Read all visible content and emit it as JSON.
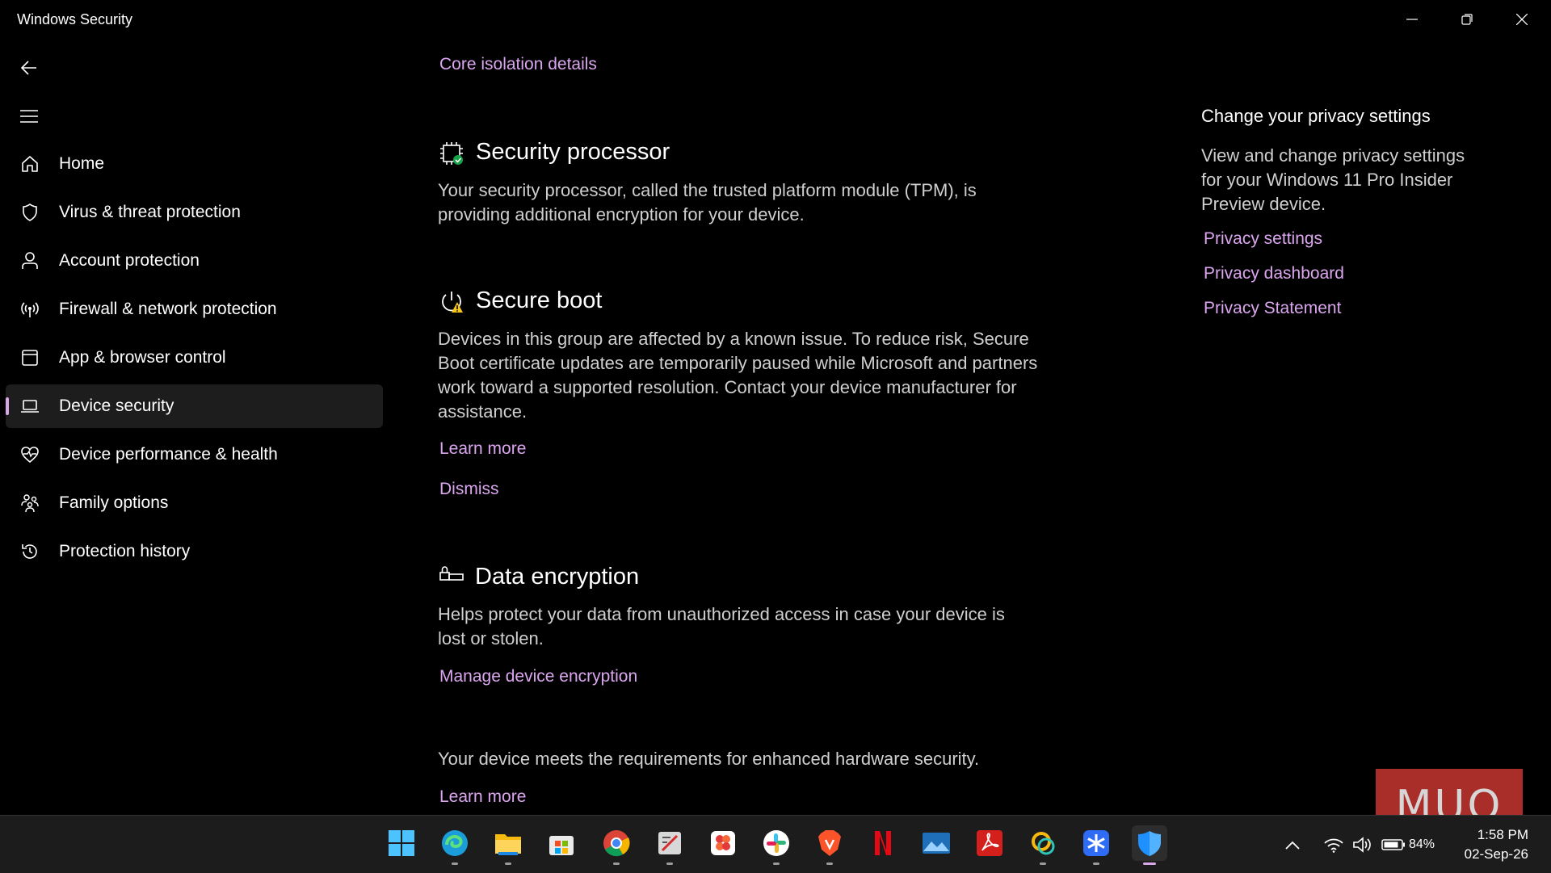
{
  "window": {
    "title": "Windows Security"
  },
  "nav": {
    "items": [
      {
        "label": "Home",
        "icon": "home-icon"
      },
      {
        "label": "Virus & threat protection",
        "icon": "shield-icon"
      },
      {
        "label": "Account protection",
        "icon": "person-icon"
      },
      {
        "label": "Firewall & network protection",
        "icon": "antenna-icon"
      },
      {
        "label": "App & browser control",
        "icon": "browser-window-icon"
      },
      {
        "label": "Device security",
        "icon": "laptop-icon",
        "active": true
      },
      {
        "label": "Device performance & health",
        "icon": "heart-pulse-icon"
      },
      {
        "label": "Family options",
        "icon": "family-icon"
      },
      {
        "label": "Protection history",
        "icon": "history-icon"
      }
    ]
  },
  "main": {
    "core_isolation_link": "Core isolation details",
    "security_processor": {
      "title": "Security processor",
      "description": "Your security processor, called the trusted platform module (TPM), is providing additional encryption for your device."
    },
    "secure_boot": {
      "title": "Secure boot",
      "description": "Devices in this group are affected by a known issue. To reduce risk, Secure Boot certificate updates are temporarily paused while Microsoft and partners work toward a supported resolution. Contact your device manufacturer for assistance.",
      "learn_more": "Learn more",
      "dismiss": "Dismiss"
    },
    "data_encryption": {
      "title": "Data encryption",
      "description": "Helps protect your data from unauthorized access in case your device is lost or stolen.",
      "manage_link": "Manage device encryption"
    },
    "footer": {
      "text": "Your device meets the requirements for enhanced hardware security.",
      "learn_more": "Learn more"
    }
  },
  "side": {
    "title": "Change your privacy settings",
    "text": "View and change privacy settings for your Windows 11 Pro Insider Preview device.",
    "links": [
      "Privacy settings",
      "Privacy dashboard",
      "Privacy Statement"
    ]
  },
  "taskbar": {
    "apps": [
      "start-icon",
      "edge-icon",
      "file-explorer-icon",
      "store-icon",
      "chrome-icon",
      "snipping-tool-icon",
      "photos-icon",
      "slack-icon",
      "brave-icon",
      "netflix-icon",
      "photos-landscape-icon",
      "acrobat-icon",
      "sync-app-icon",
      "snowflake-app-icon",
      "windows-security-icon"
    ],
    "battery": "84%",
    "time": "1:58 PM",
    "date": "02-Sep-26"
  },
  "watermark": "MUO",
  "colors": {
    "accent": "#dba6ef",
    "background": "#000000",
    "taskbar": "#1c1c1c"
  }
}
